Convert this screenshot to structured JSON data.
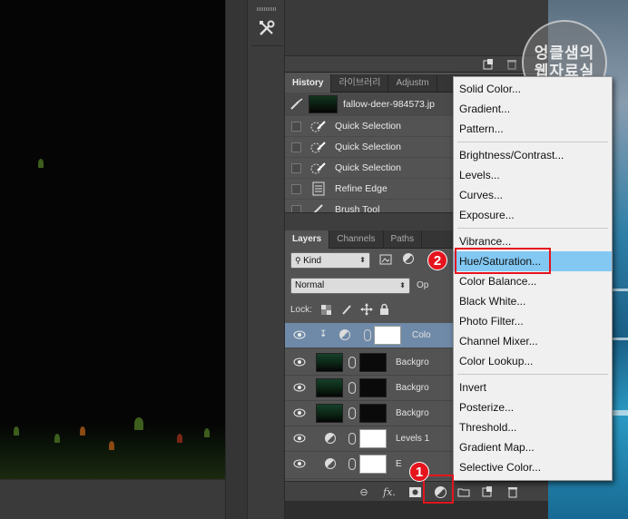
{
  "history_panel": {
    "tabs": [
      "History",
      "라이브러리",
      "Adjustm"
    ],
    "snapshot": "fallow-deer-984573.jp",
    "steps": [
      "Quick Selection",
      "Quick Selection",
      "Quick Selection",
      "Refine Edge",
      "Brush Tool"
    ]
  },
  "layers_panel": {
    "tabs": [
      "Layers",
      "Channels",
      "Paths"
    ],
    "filter_kind": "Kind",
    "blend_mode": "Normal",
    "opacity_label": "Op",
    "lock_label": "Lock:",
    "layers": [
      {
        "name": "Colo",
        "active": true
      },
      {
        "name": "Backgro",
        "active": false
      },
      {
        "name": "Backgro",
        "active": false
      },
      {
        "name": "Backgro",
        "active": false
      },
      {
        "name": "Levels 1",
        "active": false
      },
      {
        "name": "E",
        "active": false
      }
    ],
    "footer_fx": "fx."
  },
  "adjustment_menu": {
    "groups": [
      [
        "Solid Color...",
        "Gradient...",
        "Pattern..."
      ],
      [
        "Brightness/Contrast...",
        "Levels...",
        "Curves...",
        "Exposure..."
      ],
      [
        "Vibrance...",
        "Hue/Saturation...",
        "Color Balance...",
        "Black  White...",
        "Photo Filter...",
        "Channel Mixer...",
        "Color Lookup..."
      ],
      [
        "Invert",
        "Posterize...",
        "Threshold...",
        "Gradient Map...",
        "Selective Color..."
      ]
    ],
    "highlighted": "Hue/Saturation..."
  },
  "annotations": {
    "badge_1": "1",
    "badge_2": "2"
  },
  "watermark": {
    "line1": "엉클샘의",
    "line2": "웹자료실"
  },
  "colors": {
    "accent_red": "#e5141d",
    "menu_highlight": "#82c8f3",
    "active_layer": "#6f8aa8"
  }
}
